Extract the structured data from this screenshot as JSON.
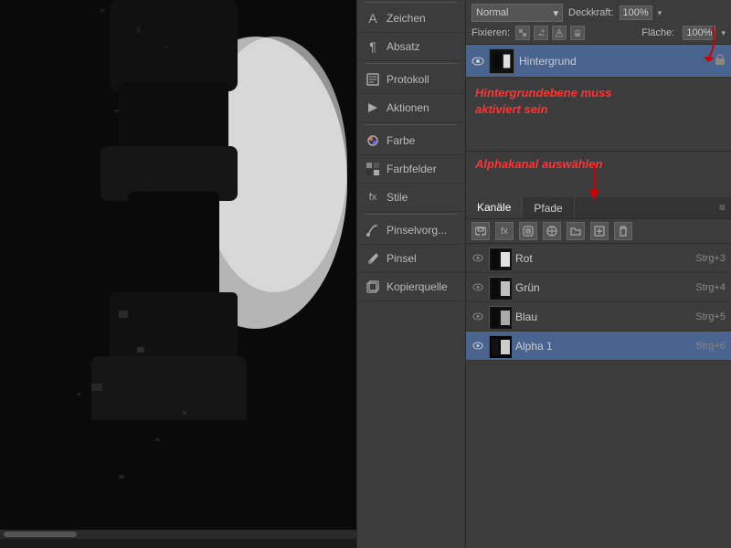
{
  "canvas": {
    "scrollbar_thumb": ""
  },
  "panels": {
    "items": [
      {
        "id": "zeichen",
        "label": "Zeichen",
        "icon": "A"
      },
      {
        "id": "absatz",
        "label": "Absatz",
        "icon": "¶"
      },
      {
        "id": "protokoll",
        "label": "Protokoll",
        "icon": "📋"
      },
      {
        "id": "aktionen",
        "label": "Aktionen",
        "icon": "▶"
      },
      {
        "id": "farbe",
        "label": "Farbe",
        "icon": "◉"
      },
      {
        "id": "farbfelder",
        "label": "Farbfelder",
        "icon": "▦"
      },
      {
        "id": "stile",
        "label": "Stile",
        "icon": "fx"
      },
      {
        "id": "pinselvorga",
        "label": "Pinselvorg...",
        "icon": "✏"
      },
      {
        "id": "pinsel",
        "label": "Pinsel",
        "icon": "🖌"
      },
      {
        "id": "kopierquelle",
        "label": "Kopierquelle",
        "icon": "⬚"
      }
    ]
  },
  "layers": {
    "blend_mode": "Normal",
    "blend_mode_arrow": "▾",
    "opacity_label": "Deckkraft:",
    "opacity_value": "100%",
    "opacity_arrow": "▾",
    "lock_label": "Fixieren:",
    "fill_label": "Fläche:",
    "fill_value": "100%",
    "fill_arrow": "▾",
    "layer_name": "Hintergrund",
    "lock_icons": [
      "▨",
      "✎",
      "↕",
      "🔒"
    ],
    "annotation1": "Hintergrundebene muss\naktiviert sein"
  },
  "channels": {
    "tabs": [
      {
        "label": "Kanäle",
        "active": true
      },
      {
        "label": "Pfade",
        "active": false
      }
    ],
    "toolbar_icons": [
      "🔗",
      "fx",
      "□",
      "◑",
      "📁",
      "⊞",
      "🗑"
    ],
    "items": [
      {
        "name": "Rot",
        "shortcut": "Strg+3",
        "active": false,
        "thumb_class": "channel-thumb-rot"
      },
      {
        "name": "Grün",
        "shortcut": "Strg+4",
        "active": false,
        "thumb_class": "channel-thumb-gru"
      },
      {
        "name": "Blau",
        "shortcut": "Strg+5",
        "active": false,
        "thumb_class": "channel-thumb-blu"
      },
      {
        "name": "Alpha 1",
        "shortcut": "Strg+6",
        "active": true,
        "thumb_class": "channel-thumb-alpha"
      }
    ],
    "annotation2": "Alphakanal auswählen"
  }
}
